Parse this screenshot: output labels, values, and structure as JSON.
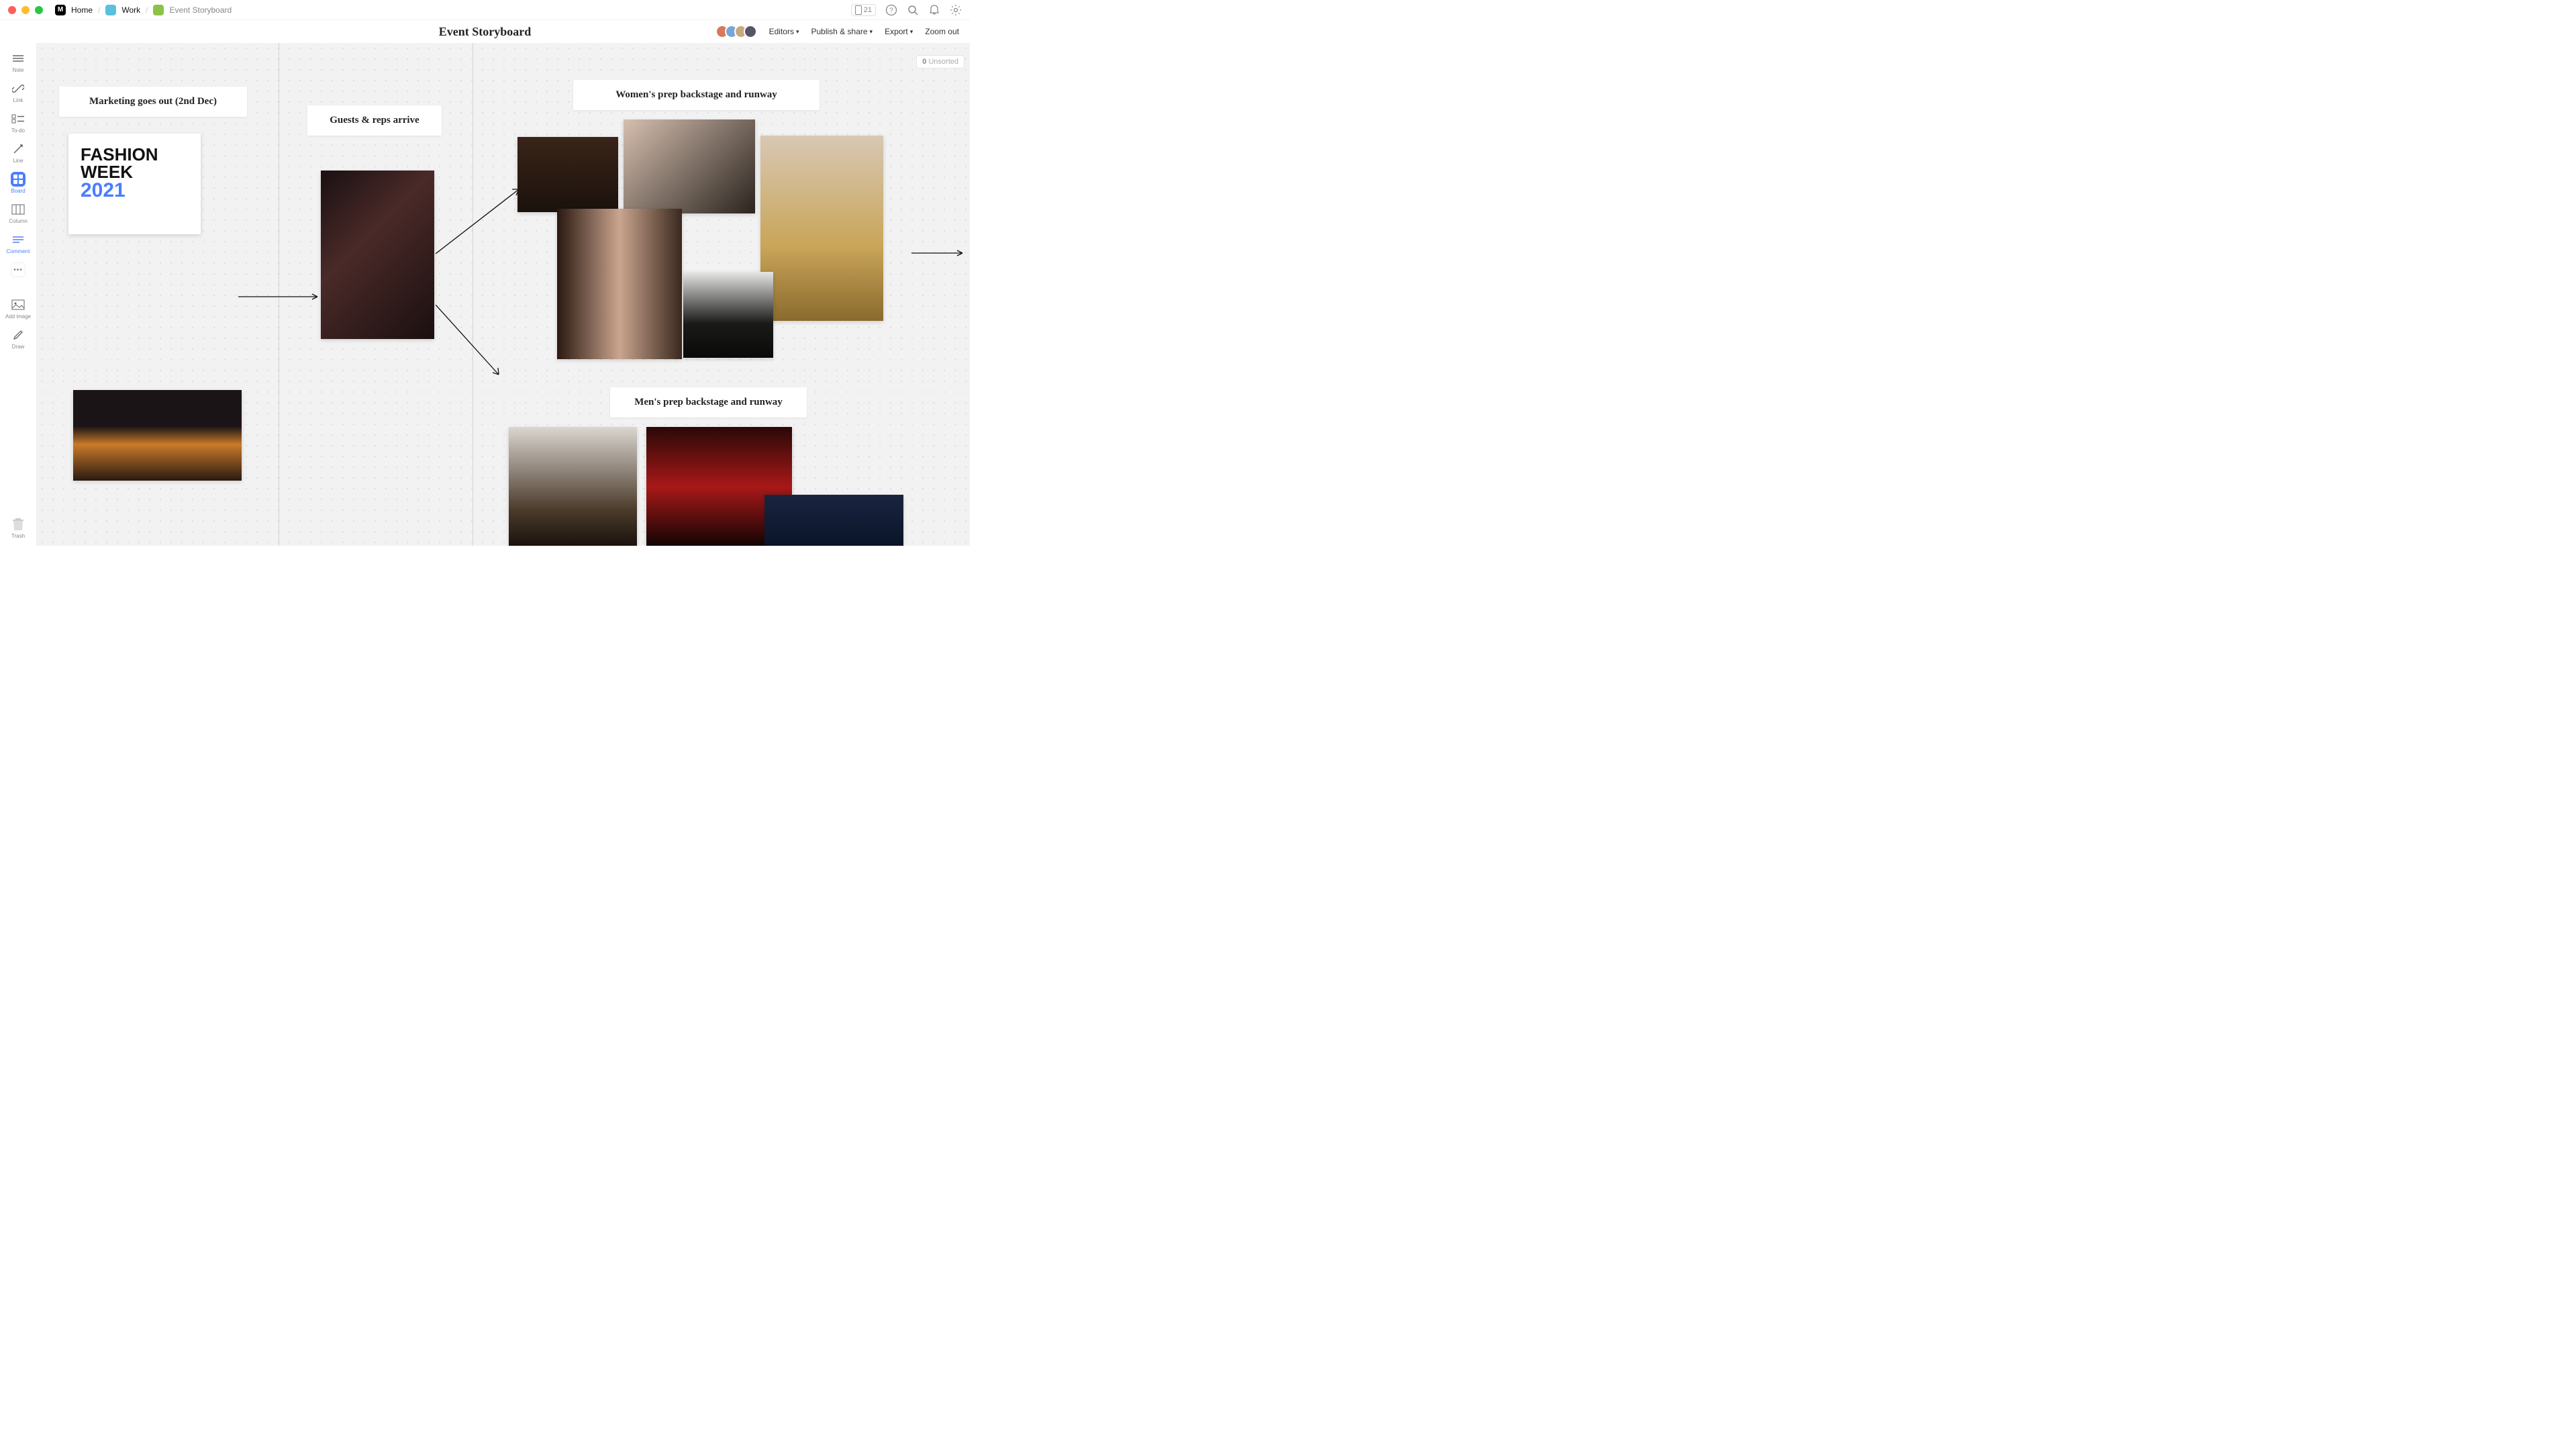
{
  "titlebar": {
    "home": "Home",
    "work": "Work",
    "current": "Event Storyboard",
    "mobile_count": "21"
  },
  "doc": {
    "title": "Event Storyboard",
    "menu": {
      "editors": "Editors",
      "publish": "Publish & share",
      "export": "Export",
      "zoomout": "Zoom out"
    }
  },
  "sidebar": {
    "note": "Note",
    "link": "Link",
    "todo": "To-do",
    "line": "Line",
    "board": "Board",
    "column": "Column",
    "comment": "Comment",
    "addimage": "Add image",
    "draw": "Draw",
    "trash": "Trash"
  },
  "canvas": {
    "unsorted_count": "0",
    "unsorted_label": "Unsorted",
    "cards": {
      "marketing": "Marketing goes out (2nd Dec)",
      "guests": "Guests & reps arrive",
      "women": "Women's prep backstage and runway",
      "men": "Men's prep backstage and runway"
    },
    "fw": {
      "line1": "FASHION",
      "line2": "WEEK",
      "year": "2021"
    }
  }
}
